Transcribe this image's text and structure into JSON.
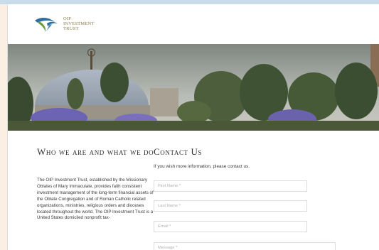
{
  "header": {
    "logo_line1": "OIP",
    "logo_line2": "INVESTMENT",
    "logo_line3": "TRUST"
  },
  "about": {
    "title": "Who we are and what we do",
    "body": "The OIP Investment Trust, established by the Missionary Oblates of Mary Immaculate, provides faith consistent investment management of the long-term financial assets of the Oblate Congregation and of Roman Catholic related organizations, ministries, religious orders and dioceses located throughout the world. The OIP Investment Trust is a United States domiciled nonprofit tax-"
  },
  "contact": {
    "title": "Contact Us",
    "intro": "If you wish more information, please contact us.",
    "first_name_placeholder": "First Name *",
    "last_name_placeholder": "Last Name *",
    "email_placeholder": "Email *",
    "message_placeholder": "Message *"
  },
  "colors": {
    "accent_gold": "#8a7a3e",
    "logo_blue": "#2f6fa0",
    "logo_green": "#6b9b3a"
  },
  "icons": {
    "logo": "oip-trust-logo-icon"
  }
}
